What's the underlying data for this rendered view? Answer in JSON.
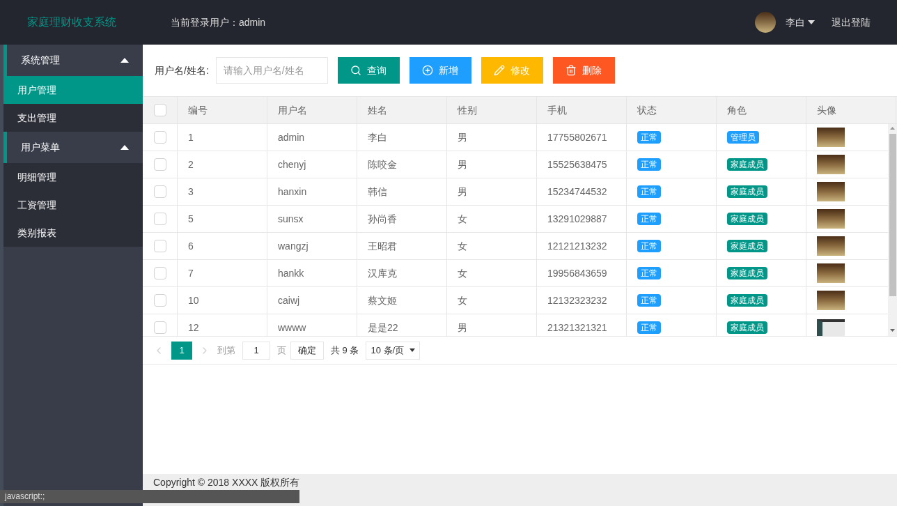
{
  "header": {
    "title": "家庭理财收支系统",
    "current_user": "当前登录用户：admin",
    "user_name": "李白",
    "logout": "退出登陆"
  },
  "sidebar": {
    "groups": [
      {
        "label": "系统管理",
        "expanded": true,
        "children": [
          {
            "label": "用户管理",
            "selected": true
          },
          {
            "label": "支出管理",
            "selected": false
          }
        ]
      },
      {
        "label": "用户菜单",
        "expanded": true,
        "children": [
          {
            "label": "明细管理",
            "selected": false
          },
          {
            "label": "工资管理",
            "selected": false
          },
          {
            "label": "类别报表",
            "selected": false
          }
        ]
      }
    ]
  },
  "toolbar": {
    "search_label": "用户名/姓名:",
    "search_placeholder": "请输入用户名/姓名",
    "buttons": [
      {
        "kind": "search",
        "label": "查询"
      },
      {
        "kind": "add",
        "label": "新增"
      },
      {
        "kind": "edit",
        "label": "修改"
      },
      {
        "kind": "delete",
        "label": "删除"
      }
    ]
  },
  "table": {
    "columns": [
      "编号",
      "用户名",
      "姓名",
      "性别",
      "手机",
      "状态",
      "角色",
      "头像"
    ],
    "header_checked": false,
    "rows": [
      {
        "checked": false,
        "cells": [
          "1",
          "admin",
          "李白",
          "男",
          "17755802671"
        ],
        "status": "正常",
        "role": {
          "label": "管理员",
          "color": "#1e9fff"
        },
        "avatar": {
          "kind": "photo"
        }
      },
      {
        "checked": false,
        "cells": [
          "2",
          "chenyj",
          "陈咬金",
          "男",
          "15525638475"
        ],
        "status": "正常",
        "role": {
          "label": "家庭成员",
          "color": "#009688"
        },
        "avatar": {
          "kind": "photo"
        }
      },
      {
        "checked": false,
        "cells": [
          "3",
          "hanxin",
          "韩信",
          "男",
          "15234744532"
        ],
        "status": "正常",
        "role": {
          "label": "家庭成员",
          "color": "#009688"
        },
        "avatar": {
          "kind": "photo"
        }
      },
      {
        "checked": false,
        "cells": [
          "5",
          "sunsx",
          "孙尚香",
          "女",
          "13291029887"
        ],
        "status": "正常",
        "role": {
          "label": "家庭成员",
          "color": "#009688"
        },
        "avatar": {
          "kind": "photo"
        }
      },
      {
        "checked": false,
        "cells": [
          "6",
          "wangzj",
          "王昭君",
          "女",
          "12121213232"
        ],
        "status": "正常",
        "role": {
          "label": "家庭成员",
          "color": "#009688"
        },
        "avatar": {
          "kind": "photo"
        }
      },
      {
        "checked": false,
        "cells": [
          "7",
          "hankk",
          "汉库克",
          "女",
          "19956843659"
        ],
        "status": "正常",
        "role": {
          "label": "家庭成员",
          "color": "#009688"
        },
        "avatar": {
          "kind": "photo"
        }
      },
      {
        "checked": false,
        "cells": [
          "10",
          "caiwj",
          "蔡文姬",
          "女",
          "12132323232"
        ],
        "status": "正常",
        "role": {
          "label": "家庭成员",
          "color": "#009688"
        },
        "avatar": {
          "kind": "photo"
        }
      },
      {
        "checked": false,
        "cells": [
          "12",
          "wwww",
          "是是22",
          "男",
          "21321321321"
        ],
        "status": "正常",
        "role": {
          "label": "家庭成员",
          "color": "#009688"
        },
        "avatar": {
          "kind": "screenshot"
        }
      }
    ]
  },
  "pagination": {
    "pages": [
      {
        "label": "1",
        "selected": true
      }
    ],
    "goto_label": "到第",
    "goto_value": "1",
    "page_unit": "页",
    "confirm": "确定",
    "total": "共 9 条",
    "page_size": "10 条/页"
  },
  "footer": {
    "copyright": "Copyright © 2018 XXXX 版权所有"
  },
  "status_bar": {
    "url": "javascript:;"
  }
}
